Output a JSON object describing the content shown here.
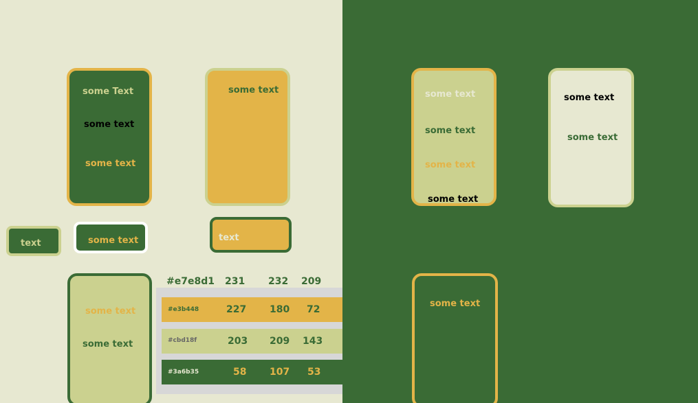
{
  "colors": {
    "cream": "#e7e8d1",
    "mustard": "#e3b448",
    "sage": "#cbd18f",
    "green": "#3a6b35",
    "white": "#ffffff",
    "black": "#000000",
    "table_bg": "#d7d7d7"
  },
  "left": {
    "card1": {
      "text1": "some Text",
      "text2": "some text",
      "text3": "some text"
    },
    "card2": {
      "text1": "some text"
    },
    "pill1": {
      "label": "text"
    },
    "pill2": {
      "label": "some text"
    },
    "pill3": {
      "label": "text"
    },
    "card3": {
      "text1": "some text",
      "text2": "some text"
    },
    "palette": {
      "header": {
        "hex": "#e7e8d1",
        "r": "231",
        "g": "232",
        "b": "209"
      },
      "rows": [
        {
          "hex": "#e3b448",
          "r": "227",
          "g": "180",
          "b": "72"
        },
        {
          "hex": "#cbd18f",
          "r": "203",
          "g": "209",
          "b": "143"
        },
        {
          "hex": "#3a6b35",
          "r": "58",
          "g": "107",
          "b": "53"
        }
      ]
    }
  },
  "right": {
    "card1": {
      "text1": "some text",
      "text2": "some text",
      "text3": "some text",
      "text4": "some text"
    },
    "card2": {
      "text1": "some text",
      "text2": "some text"
    },
    "card3": {
      "text1": "some text"
    }
  }
}
